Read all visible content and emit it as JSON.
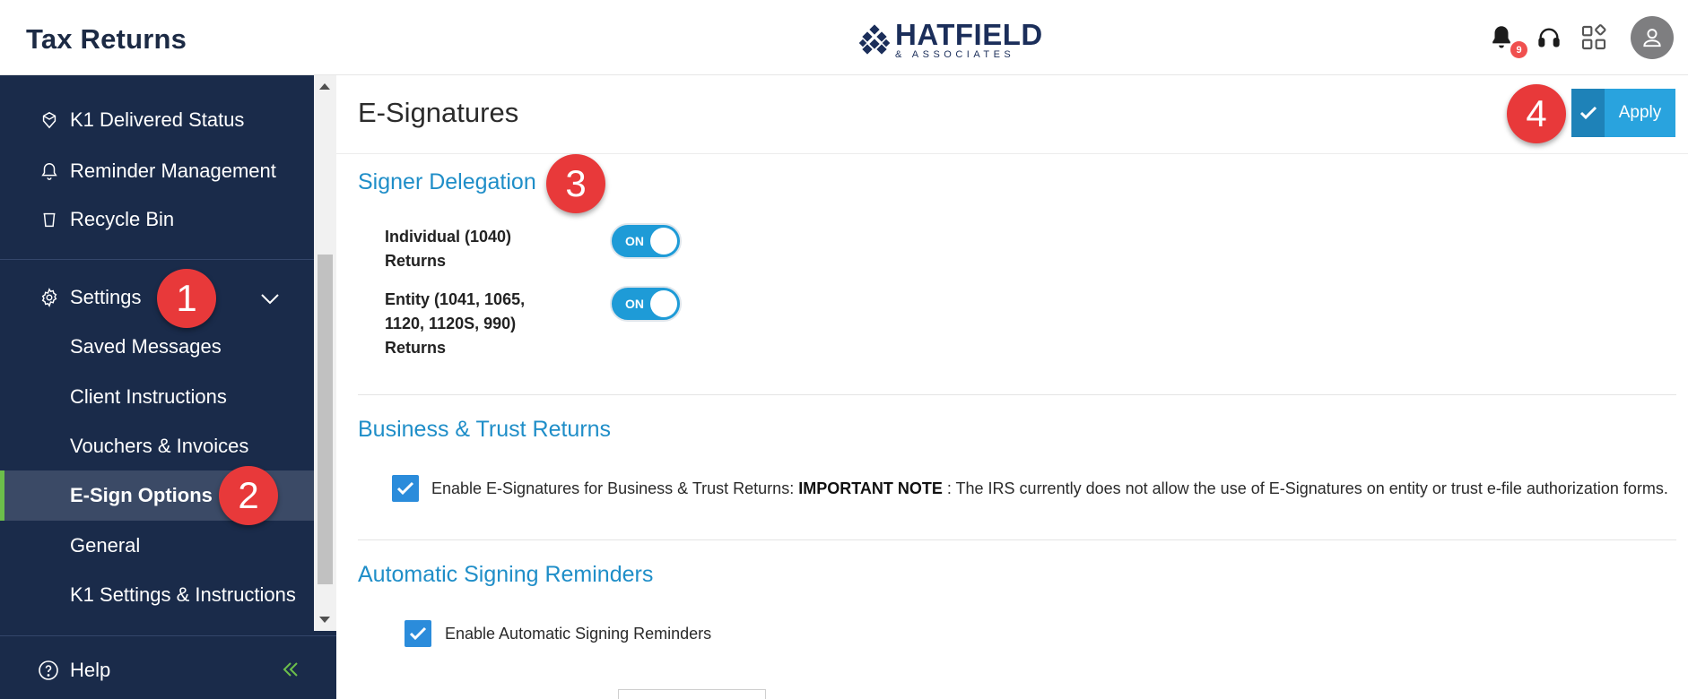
{
  "header": {
    "app_title": "Tax Returns",
    "logo": {
      "name": "HATFIELD",
      "sub": "& ASSOCIATES"
    },
    "notification_count": "9",
    "icons": [
      "bell-icon",
      "headset-icon",
      "apps-grid-icon",
      "user-avatar-icon"
    ]
  },
  "sidebar": {
    "top_items": [
      {
        "label": "K1 Delivered Status",
        "icon": "k1-status-icon"
      },
      {
        "label": "Reminder Management",
        "icon": "bell-icon"
      },
      {
        "label": "Recycle Bin",
        "icon": "trash-icon"
      }
    ],
    "settings": {
      "label": "Settings",
      "icon": "gear-icon",
      "expanded": true
    },
    "settings_items": [
      {
        "label": "Saved Messages"
      },
      {
        "label": "Client Instructions"
      },
      {
        "label": "Vouchers & Invoices"
      },
      {
        "label": "E-Sign Options",
        "active": true
      },
      {
        "label": "General"
      },
      {
        "label": "K1 Settings & Instructions"
      }
    ],
    "help": {
      "label": "Help",
      "icon": "help-circle-icon"
    }
  },
  "page": {
    "title": "E-Signatures",
    "apply_label": "Apply",
    "signer_delegation": {
      "title": "Signer Delegation",
      "rows": [
        {
          "label": "Individual (1040) Returns",
          "state": "ON"
        },
        {
          "label": "Entity (1041, 1065, 1120, 1120S, 990) Returns",
          "state": "ON"
        }
      ]
    },
    "business_trust": {
      "title": "Business & Trust Returns",
      "checkbox_label": "Enable E-Signatures for Business & Trust Returns: ",
      "note_bold": "IMPORTANT NOTE",
      "note_text": " : The IRS currently does not allow the use of E-Signatures on entity or trust e-file authorization forms.",
      "checked": true
    },
    "auto_reminders": {
      "title": "Automatic Signing Reminders",
      "checkbox_label": "Enable Automatic Signing Reminders",
      "checked": true
    }
  },
  "annotations": [
    "1",
    "2",
    "3",
    "4"
  ],
  "colors": {
    "sidebar_bg": "#1a2b4a",
    "accent_blue": "#1f8ec8",
    "toggle_on": "#1e9bd7",
    "checkbox": "#2b8cdb",
    "active_indicator": "#6cbf4a",
    "marker_red": "#e8393a"
  }
}
